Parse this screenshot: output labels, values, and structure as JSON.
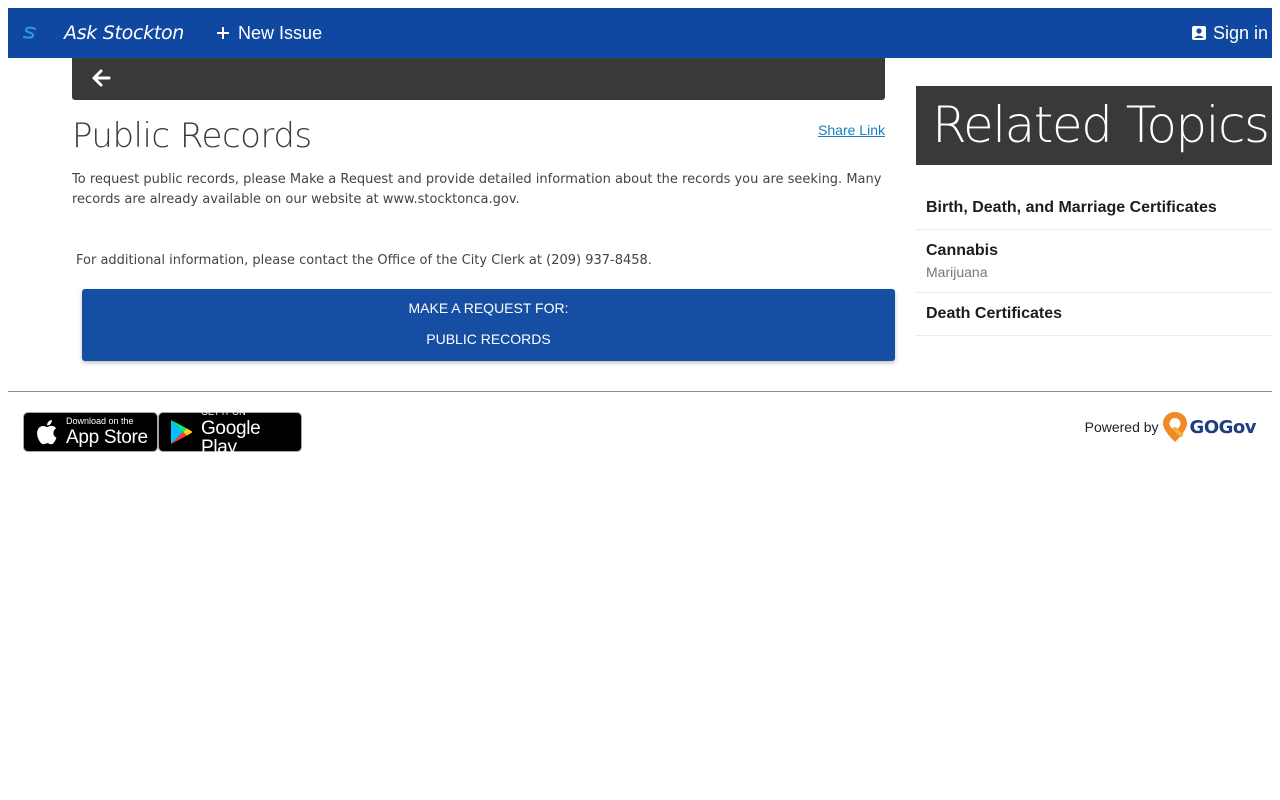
{
  "nav": {
    "brand": "Ask Stockton",
    "new_issue": "New Issue",
    "sign_in": "Sign in"
  },
  "main": {
    "title": "Public Records",
    "share_link": "Share Link",
    "description": "To request public records, please Make a Request and provide detailed information about the records you are seeking. Many records are already available on our website at www.stocktonca.gov.",
    "contact": "For additional information, please contact the Office of the City Clerk at (209) 937-8458.",
    "request_button": {
      "line1": "MAKE A REQUEST FOR:",
      "line2": "PUBLIC RECORDS"
    }
  },
  "sidebar": {
    "header": "Related Topics",
    "items": [
      {
        "name": "Birth, Death, and Marriage Certificates",
        "sub": ""
      },
      {
        "name": "Cannabis",
        "sub": "Marijuana"
      },
      {
        "name": "Death Certificates",
        "sub": ""
      }
    ]
  },
  "footer": {
    "app_store": {
      "small": "Download on the",
      "big": "App Store"
    },
    "google_play": {
      "small": "GET IT ON",
      "big": "Google Play"
    },
    "powered_by": "Powered by",
    "gogov": "GOGov"
  },
  "colors": {
    "nav_bg": "#0f47a1",
    "dark_bar": "#3a393a",
    "button_bg": "#164ea4",
    "link": "#1a7fc1"
  },
  "icons": {
    "logo": "stockton-logo-icon",
    "plus": "plus-icon",
    "account": "account-box-icon",
    "back": "arrow-left-icon",
    "apple": "apple-icon",
    "google_play": "google-play-icon",
    "gogov": "gogov-pin-icon"
  }
}
